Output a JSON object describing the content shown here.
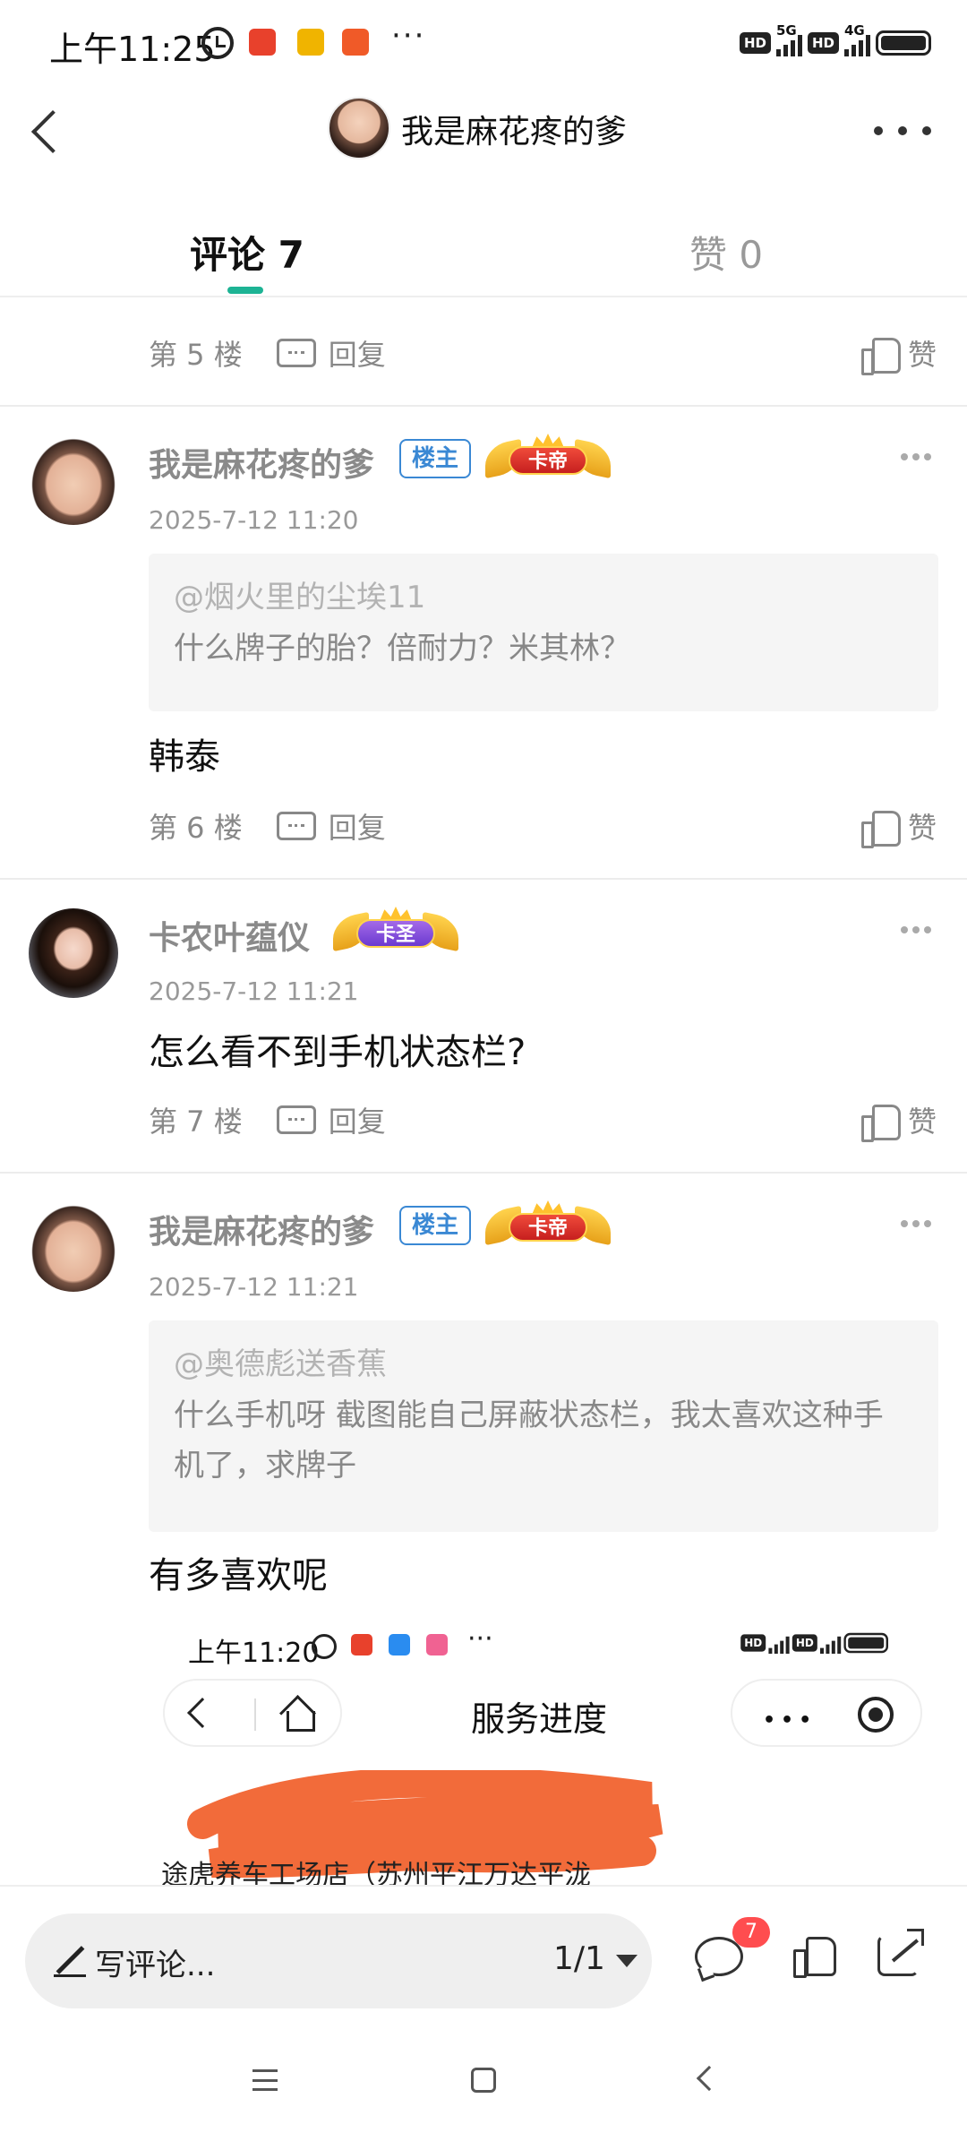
{
  "status_bar": {
    "time": "上午11:25",
    "app_icons": [
      {
        "name": "app-icon-1",
        "color": "#e8412c",
        "label": "苏宁"
      },
      {
        "name": "app-icon-2",
        "color": "#f0b400",
        "label": "团"
      },
      {
        "name": "app-icon-3",
        "color": "#f05a28",
        "label": "邮"
      }
    ],
    "more": "···",
    "hd_1": "HD",
    "net_1": "5G",
    "hd_2": "HD",
    "net_2": "4G"
  },
  "nav": {
    "title": "我是麻花疼的爹"
  },
  "tabs": {
    "comments": "评论 7",
    "likes": "赞 0"
  },
  "common": {
    "reply": "回复",
    "like": "赞"
  },
  "posts": {
    "p5": {
      "floor": "第 5 楼"
    },
    "p6": {
      "username": "我是麻花疼的爹",
      "op_badge": "楼主",
      "rank_badge": "卡帝",
      "time": "2025-7-12 11:20",
      "quote_at": "@烟火里的尘埃11",
      "quote_text": "什么牌子的胎？倍耐力？米其林？",
      "comment": "韩泰",
      "floor": "第 6 楼"
    },
    "p7": {
      "username": "卡农叶蕴仪",
      "rank_badge": "卡圣",
      "time": "2025-7-12 11:21",
      "comment": "怎么看不到手机状态栏?",
      "floor": "第 7 楼"
    },
    "p8": {
      "username": "我是麻花疼的爹",
      "op_badge": "楼主",
      "rank_badge": "卡帝",
      "time": "2025-7-12 11:21",
      "quote_at": "@奥德彪送香蕉",
      "quote_text": "什么手机呀 截图能自己屏蔽状态栏，我太喜欢这种手机了，求牌子",
      "comment": "有多喜欢呢"
    }
  },
  "embedded_screenshot": {
    "time": "上午11:20",
    "more": "···",
    "title": "服务进度",
    "partial_line": "途虎养车工场店（苏州平江万达平泷"
  },
  "bottom_bar": {
    "placeholder": "写评论...",
    "page": "1/1",
    "comment_count": "7"
  },
  "colors": {
    "accent": "#1db394",
    "op_badge": "#3a88d4",
    "badge_red": "#ff4d4f",
    "redaction": "#f26b3a"
  }
}
